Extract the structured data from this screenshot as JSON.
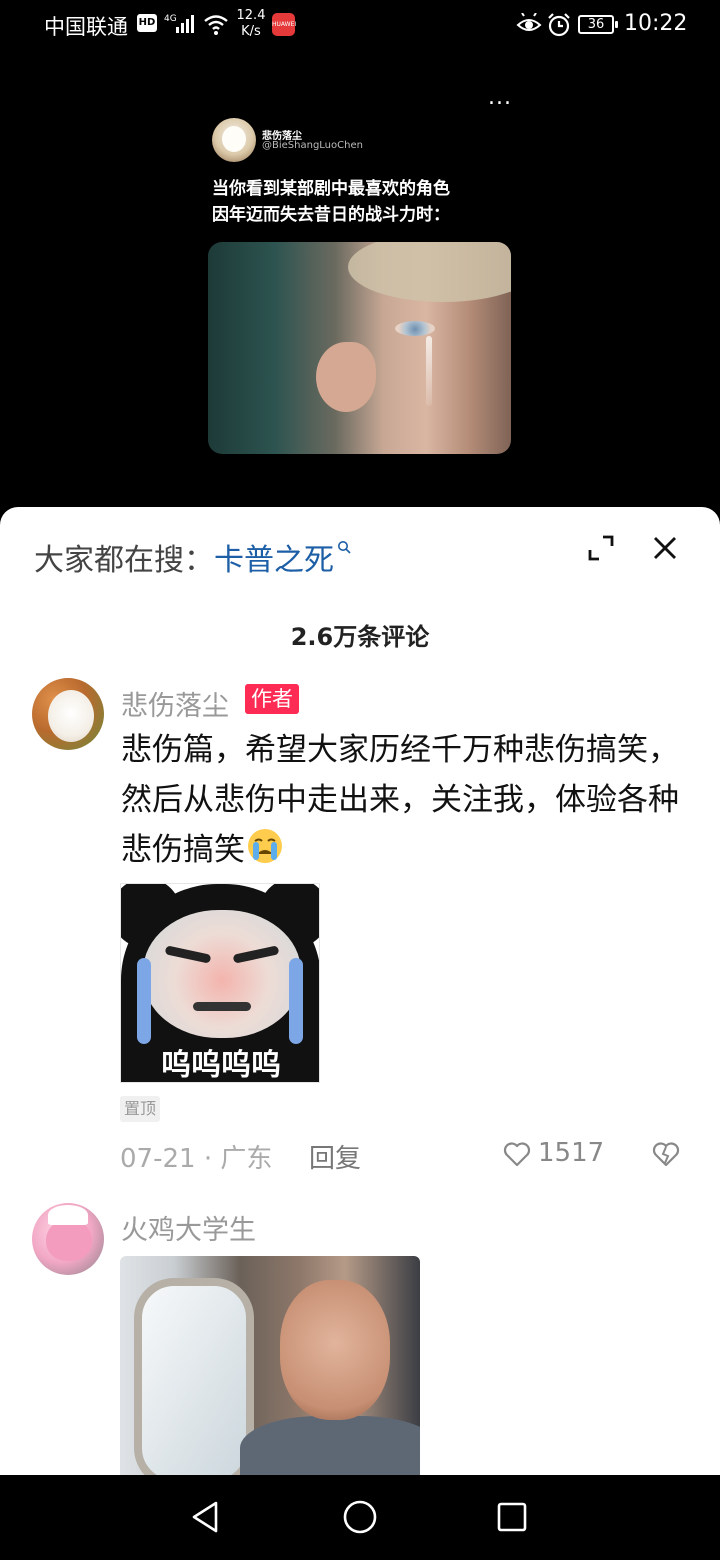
{
  "status_bar": {
    "carrier": "中国联通",
    "hd_badge": "HD",
    "network": "4G",
    "speed_value": "12.4",
    "speed_unit": "K/s",
    "app_badge": "HUAWEI",
    "battery": "36",
    "time": "10:22"
  },
  "video": {
    "more_label": "...",
    "tweet": {
      "name": "悲伤落尘",
      "handle": "@BieShangLuoChen",
      "line1": "当你看到某部剧中最喜欢的角色",
      "line2": "因年迈而失去昔日的战斗力时："
    }
  },
  "sheet": {
    "search_prefix": "大家都在搜：",
    "search_term": "卡普之死",
    "comment_count": "2.6万条评论",
    "comments": [
      {
        "author": "悲伤落尘",
        "badge": "作者",
        "text": "悲伤篇，希望大家历经千万种悲伤搞笑，然后从悲伤中走出来，关注我，体验各种悲伤搞笑",
        "sticker_caption": "呜呜呜呜",
        "pinned": "置顶",
        "date_location": "07-21 · 广东",
        "reply": "回复",
        "likes": "1517"
      },
      {
        "author": "火鸡大学生"
      }
    ]
  }
}
